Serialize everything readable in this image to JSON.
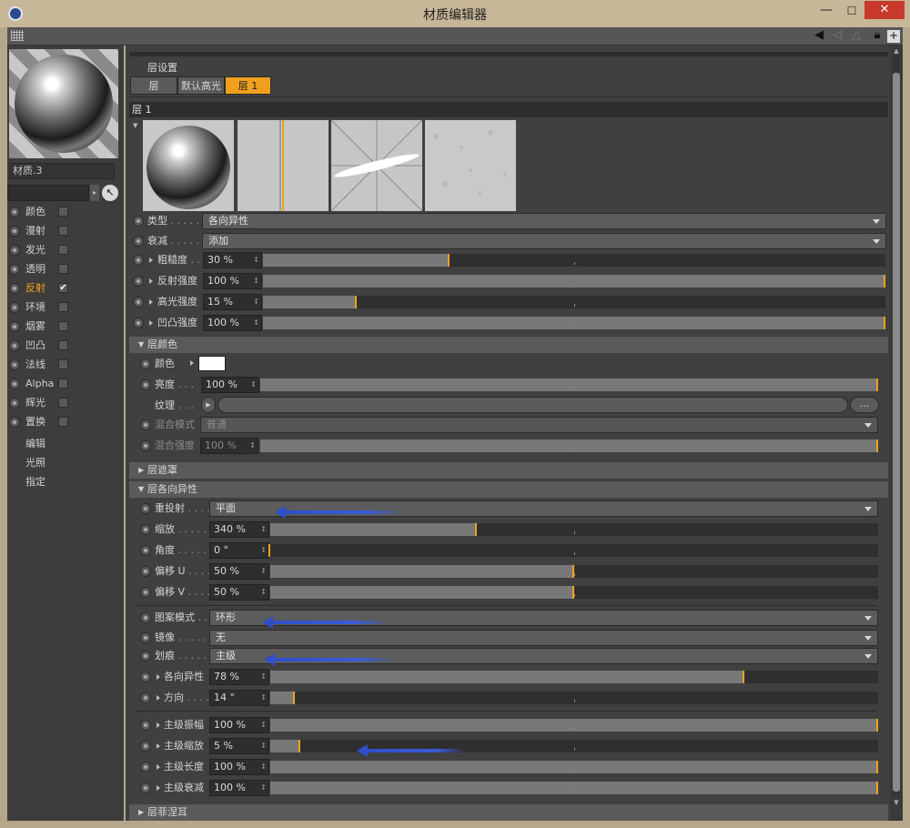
{
  "window": {
    "title": "材质编辑器",
    "minimize": "—",
    "maximize": "☐",
    "close": "✕"
  },
  "material": {
    "name": "材质.3"
  },
  "channels": [
    {
      "label": "颜色",
      "checked": false,
      "active": false
    },
    {
      "label": "漫射",
      "checked": false,
      "active": false
    },
    {
      "label": "发光",
      "checked": false,
      "active": false
    },
    {
      "label": "透明",
      "checked": false,
      "active": false
    },
    {
      "label": "反射",
      "checked": true,
      "active": true
    },
    {
      "label": "环境",
      "checked": false,
      "active": false
    },
    {
      "label": "烟雾",
      "checked": false,
      "active": false
    },
    {
      "label": "凹凸",
      "checked": false,
      "active": false
    },
    {
      "label": "法线",
      "checked": false,
      "active": false
    },
    {
      "label": "Alpha",
      "checked": false,
      "active": false
    },
    {
      "label": "辉光",
      "checked": false,
      "active": false
    },
    {
      "label": "置换",
      "checked": false,
      "active": false
    }
  ],
  "nav": {
    "edit": "编辑",
    "illumination": "光照",
    "assign": "指定"
  },
  "layer_settings": {
    "title": "层设置",
    "tabs": [
      {
        "label": "层",
        "selected": false
      },
      {
        "label": "默认高光",
        "selected": false
      },
      {
        "label": "层 1",
        "selected": true
      }
    ],
    "layer_name": "层 1"
  },
  "props": {
    "type": {
      "label": "类型",
      "dots": " . . . . .",
      "value": "各向异性"
    },
    "attenuation": {
      "label": "衰减",
      "dots": " . . . . .",
      "value": "添加"
    },
    "roughness": {
      "label": "粗糙度",
      "dots": " . .",
      "value": "30 %",
      "pct": 30
    },
    "refl_strength": {
      "label": "反射强度",
      "value": "100 %",
      "pct": 100
    },
    "spec_strength": {
      "label": "高光强度",
      "value": "15 %",
      "pct": 15
    },
    "bump_strength": {
      "label": "凹凸强度",
      "value": "100 %",
      "pct": 100
    }
  },
  "layer_color": {
    "section": "层颜色",
    "color": {
      "label": "颜色",
      "value": "#ffffff"
    },
    "brightness": {
      "label": "亮度",
      "dots": " . . .",
      "value": "100 %",
      "pct": 100
    },
    "texture": {
      "label": "纹理",
      "dots": " . . .",
      "more": "..."
    },
    "blend_mode": {
      "label": "混合模式",
      "value": "普通"
    },
    "blend_strength": {
      "label": "混合强度",
      "value": "100 %",
      "pct": 100
    }
  },
  "layer_mask": {
    "section": "层遮罩"
  },
  "anisotropy": {
    "section": "层各向异性",
    "reprojection": {
      "label": "重投射",
      "dots": " . . . .",
      "value": "平面"
    },
    "scale": {
      "label": "缩放",
      "dots": " . . . . .",
      "value": "340 %",
      "pct": 34
    },
    "angle": {
      "label": "角度",
      "dots": " . . . . .",
      "value": "0 °",
      "pct": 0
    },
    "offset_u": {
      "label": "偏移 U",
      "dots": " . . . .",
      "value": "50 %",
      "pct": 50
    },
    "offset_v": {
      "label": "偏移 V",
      "dots": " . . . .",
      "value": "50 %",
      "pct": 50
    },
    "pattern_mode": {
      "label": "图案模式",
      "dots": " . .",
      "value": "环形"
    },
    "mirror": {
      "label": "镜像",
      "dots": " . . . . .",
      "value": "无"
    },
    "scratch": {
      "label": "划痕",
      "dots": " . . . . .",
      "value": "主级"
    },
    "aniso": {
      "label": "各向异性",
      "value": "78 %",
      "pct": 78
    },
    "orientation": {
      "label": "方向",
      "dots": " . . . .",
      "value": "14 °",
      "pct": 4
    },
    "primary_amplitude": {
      "label": "主级振幅",
      "value": "100 %",
      "pct": 100
    },
    "primary_scale": {
      "label": "主级缩放",
      "value": "5 %",
      "pct": 5
    },
    "primary_length": {
      "label": "主级长度",
      "value": "100 %",
      "pct": 100
    },
    "primary_attenuation": {
      "label": "主级衰减",
      "value": "100 %",
      "pct": 100
    }
  },
  "layer_fresnel": {
    "section": "层菲涅耳"
  },
  "colors": {
    "accent": "#f0a01e",
    "annotation_arrow": "#3357d0",
    "close_button": "#c73a2c"
  }
}
